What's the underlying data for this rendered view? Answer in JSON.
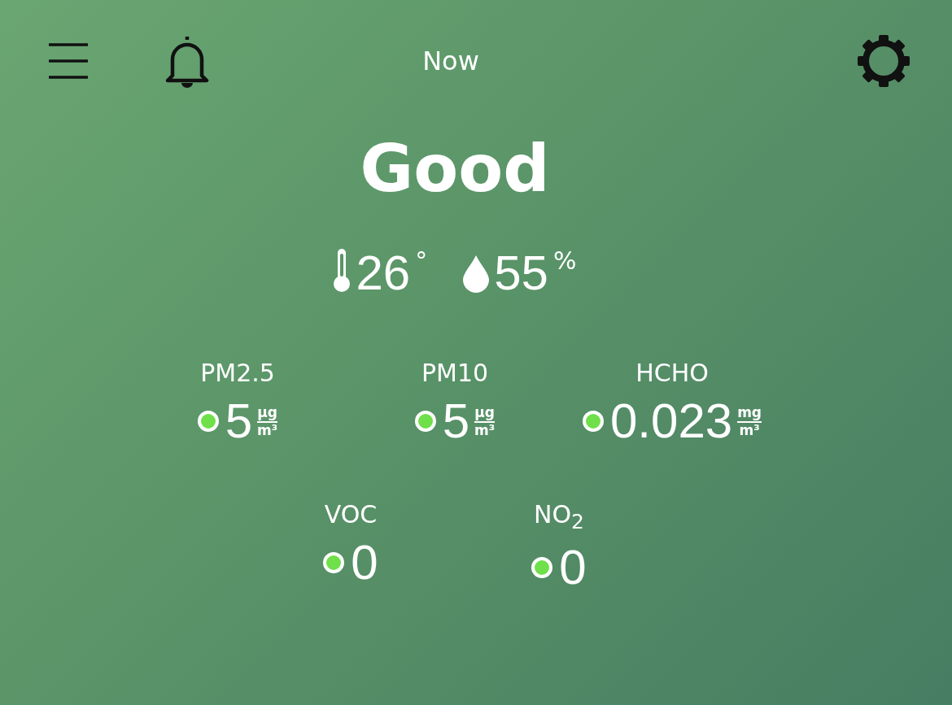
{
  "header": {
    "title": "Now"
  },
  "status": "Good",
  "climate": [
    {
      "kind": "temperature",
      "value": "26",
      "unit": "°"
    },
    {
      "kind": "humidity",
      "value": "55",
      "unit": "%"
    }
  ],
  "metric_rows": [
    [
      {
        "label": "PM2.5",
        "value": "5",
        "unit_top": "µg",
        "unit_bottom": "m³",
        "color": "#6fe04a"
      },
      {
        "label": "PM10",
        "value": "5",
        "unit_top": "µg",
        "unit_bottom": "m³",
        "color": "#6fe04a"
      },
      {
        "label": "HCHO",
        "value": "0.023",
        "unit_top": "mg",
        "unit_bottom": "m³",
        "color": "#6fe04a"
      }
    ],
    [
      {
        "label": "VOC",
        "value": "0",
        "color": "#6fe04a"
      },
      {
        "label": "NO$_{2}$",
        "value": "0",
        "color": "#6fe04a"
      }
    ]
  ]
}
